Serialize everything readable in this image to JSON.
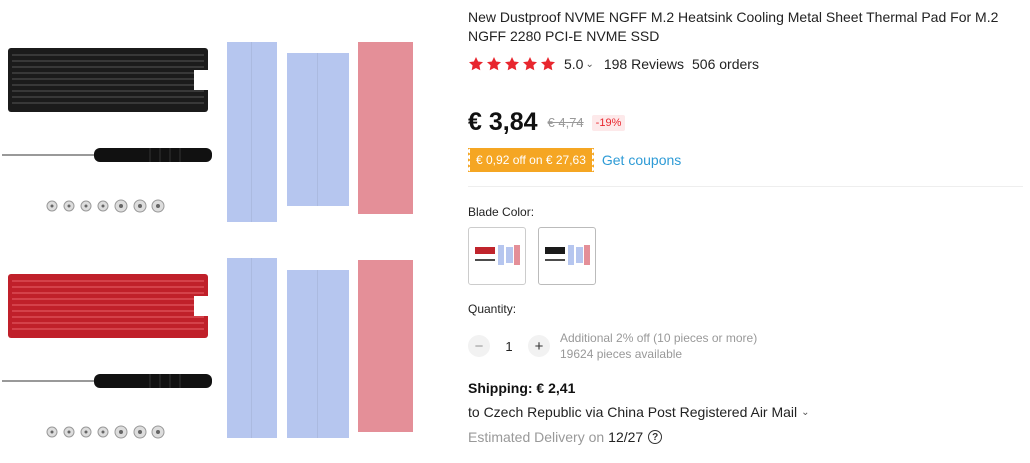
{
  "product": {
    "title": "New Dustproof NVME NGFF M.2 Heatsink Cooling Metal Sheet Thermal Pad For M.2 NGFF 2280 PCI-E NVME SSD",
    "rating_score": "5.0",
    "reviews": "198 Reviews",
    "orders": "506 orders",
    "star_color": "#e8262e"
  },
  "price": {
    "current": "€ 3,84",
    "original": "€ 4,74",
    "discount": "-19%"
  },
  "coupon": {
    "badge": "€ 0,92 off on € 27,63",
    "link": "Get coupons",
    "badge_color": "#f5a623"
  },
  "color_option": {
    "label": "Blade Color:",
    "swatches": [
      {
        "name": "red",
        "color": "#c0242c"
      },
      {
        "name": "black",
        "color": "#1a1a1a"
      }
    ]
  },
  "quantity": {
    "label": "Quantity:",
    "value": "1",
    "minus": "−",
    "plus": "+",
    "note_discount": "Additional 2% off (10 pieces or more)",
    "note_available": "19624 pieces available"
  },
  "shipping": {
    "title": "Shipping: € 2,41",
    "destination": "to Czech Republic via China Post Registered Air Mail",
    "delivery_label": "Estimated Delivery on",
    "delivery_date": "12/27"
  },
  "icons": {
    "caret": "⌄",
    "help": "?"
  },
  "gallery": {
    "heatsink_colors": [
      "#1b1b1b",
      "#c0202a"
    ],
    "pad_colors": [
      "#b6c6ef",
      "#e48f98"
    ]
  }
}
